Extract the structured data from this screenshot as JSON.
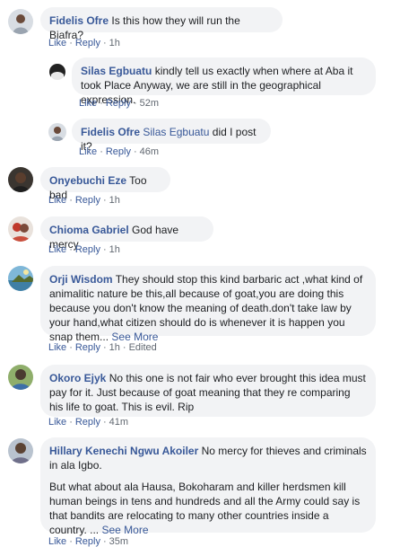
{
  "comments": [
    {
      "author": "Fidelis Ofre",
      "text": "Is this how they will run the Biafra?",
      "like": "Like",
      "reply": "Reply",
      "time": "1h"
    },
    {
      "author": "Silas Egbuatu",
      "text": "kindly tell us exactly when where at Aba it took Place Anyway, we are still in the geographical expression.",
      "like": "Like",
      "reply": "Reply",
      "time": "52m"
    },
    {
      "author": "Fidelis Ofre",
      "mention": "Silas Egbuatu",
      "text": "did I post it?",
      "like": "Like",
      "reply": "Reply",
      "time": "46m"
    },
    {
      "author": "Onyebuchi Eze",
      "text": "Too bad",
      "like": "Like",
      "reply": "Reply",
      "time": "1h"
    },
    {
      "author": "Chioma Gabriel",
      "text": "God have mercy",
      "like": "Like",
      "reply": "Reply",
      "time": "1h"
    },
    {
      "author": "Orji Wisdom",
      "text": "They should stop this kind barbaric act ,what kind of animalitic nature be this,all because of goat,you are doing this because you don't know the meaning of death.don't take law by your hand,what citizen should do is whenever it is happen you snap them...",
      "see_more": "See More",
      "like": "Like",
      "reply": "Reply",
      "time": "1h",
      "edited": "Edited"
    },
    {
      "author": "Okoro Ejyk",
      "text": "No this one is not fair who ever brought this idea must pay for it. Just because of goat meaning that they re comparing his life to goat. This is evil. Rip",
      "like": "Like",
      "reply": "Reply",
      "time": "41m"
    },
    {
      "author": "Hillary Kenechi Ngwu Akoiler",
      "text": "No mercy for thieves and criminals in ala Igbo.",
      "text2": "But what about ala Hausa, Bokoharam and killer herdsmen kill human beings in tens and hundreds and all the Army could say is that bandits are relocating to many other countries inside a country. ...",
      "see_more": "See More",
      "like": "Like",
      "reply": "Reply",
      "time": "35m"
    }
  ],
  "colors": {
    "link": "#385898",
    "bubble": "#f2f3f5",
    "meta": "#606770",
    "text": "#1c1e21"
  }
}
